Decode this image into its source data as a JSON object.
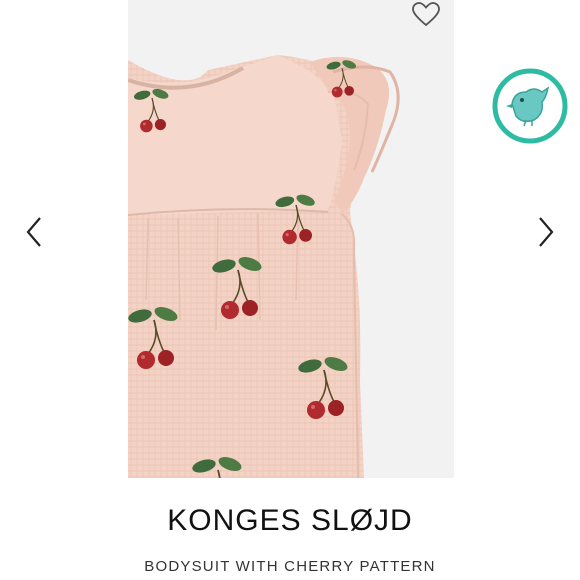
{
  "product": {
    "brand": "KONGES SLØJD",
    "title": "BODYSUIT WITH CHERRY PATTERN"
  },
  "icons": {
    "favorite": "heart-outline-icon",
    "previous": "chevron-left-icon",
    "next": "chevron-right-icon",
    "badge": "bird-badge-icon"
  },
  "colors": {
    "fabric": "#f3d3c6",
    "cherry": "#b02a2e",
    "leaf": "#3f6b3d",
    "badge_ring": "#2dbba3",
    "badge_fill": "#69c8c2",
    "text_primary": "#111111",
    "text_secondary": "#333333",
    "photo_background": "#f2f2f2"
  }
}
